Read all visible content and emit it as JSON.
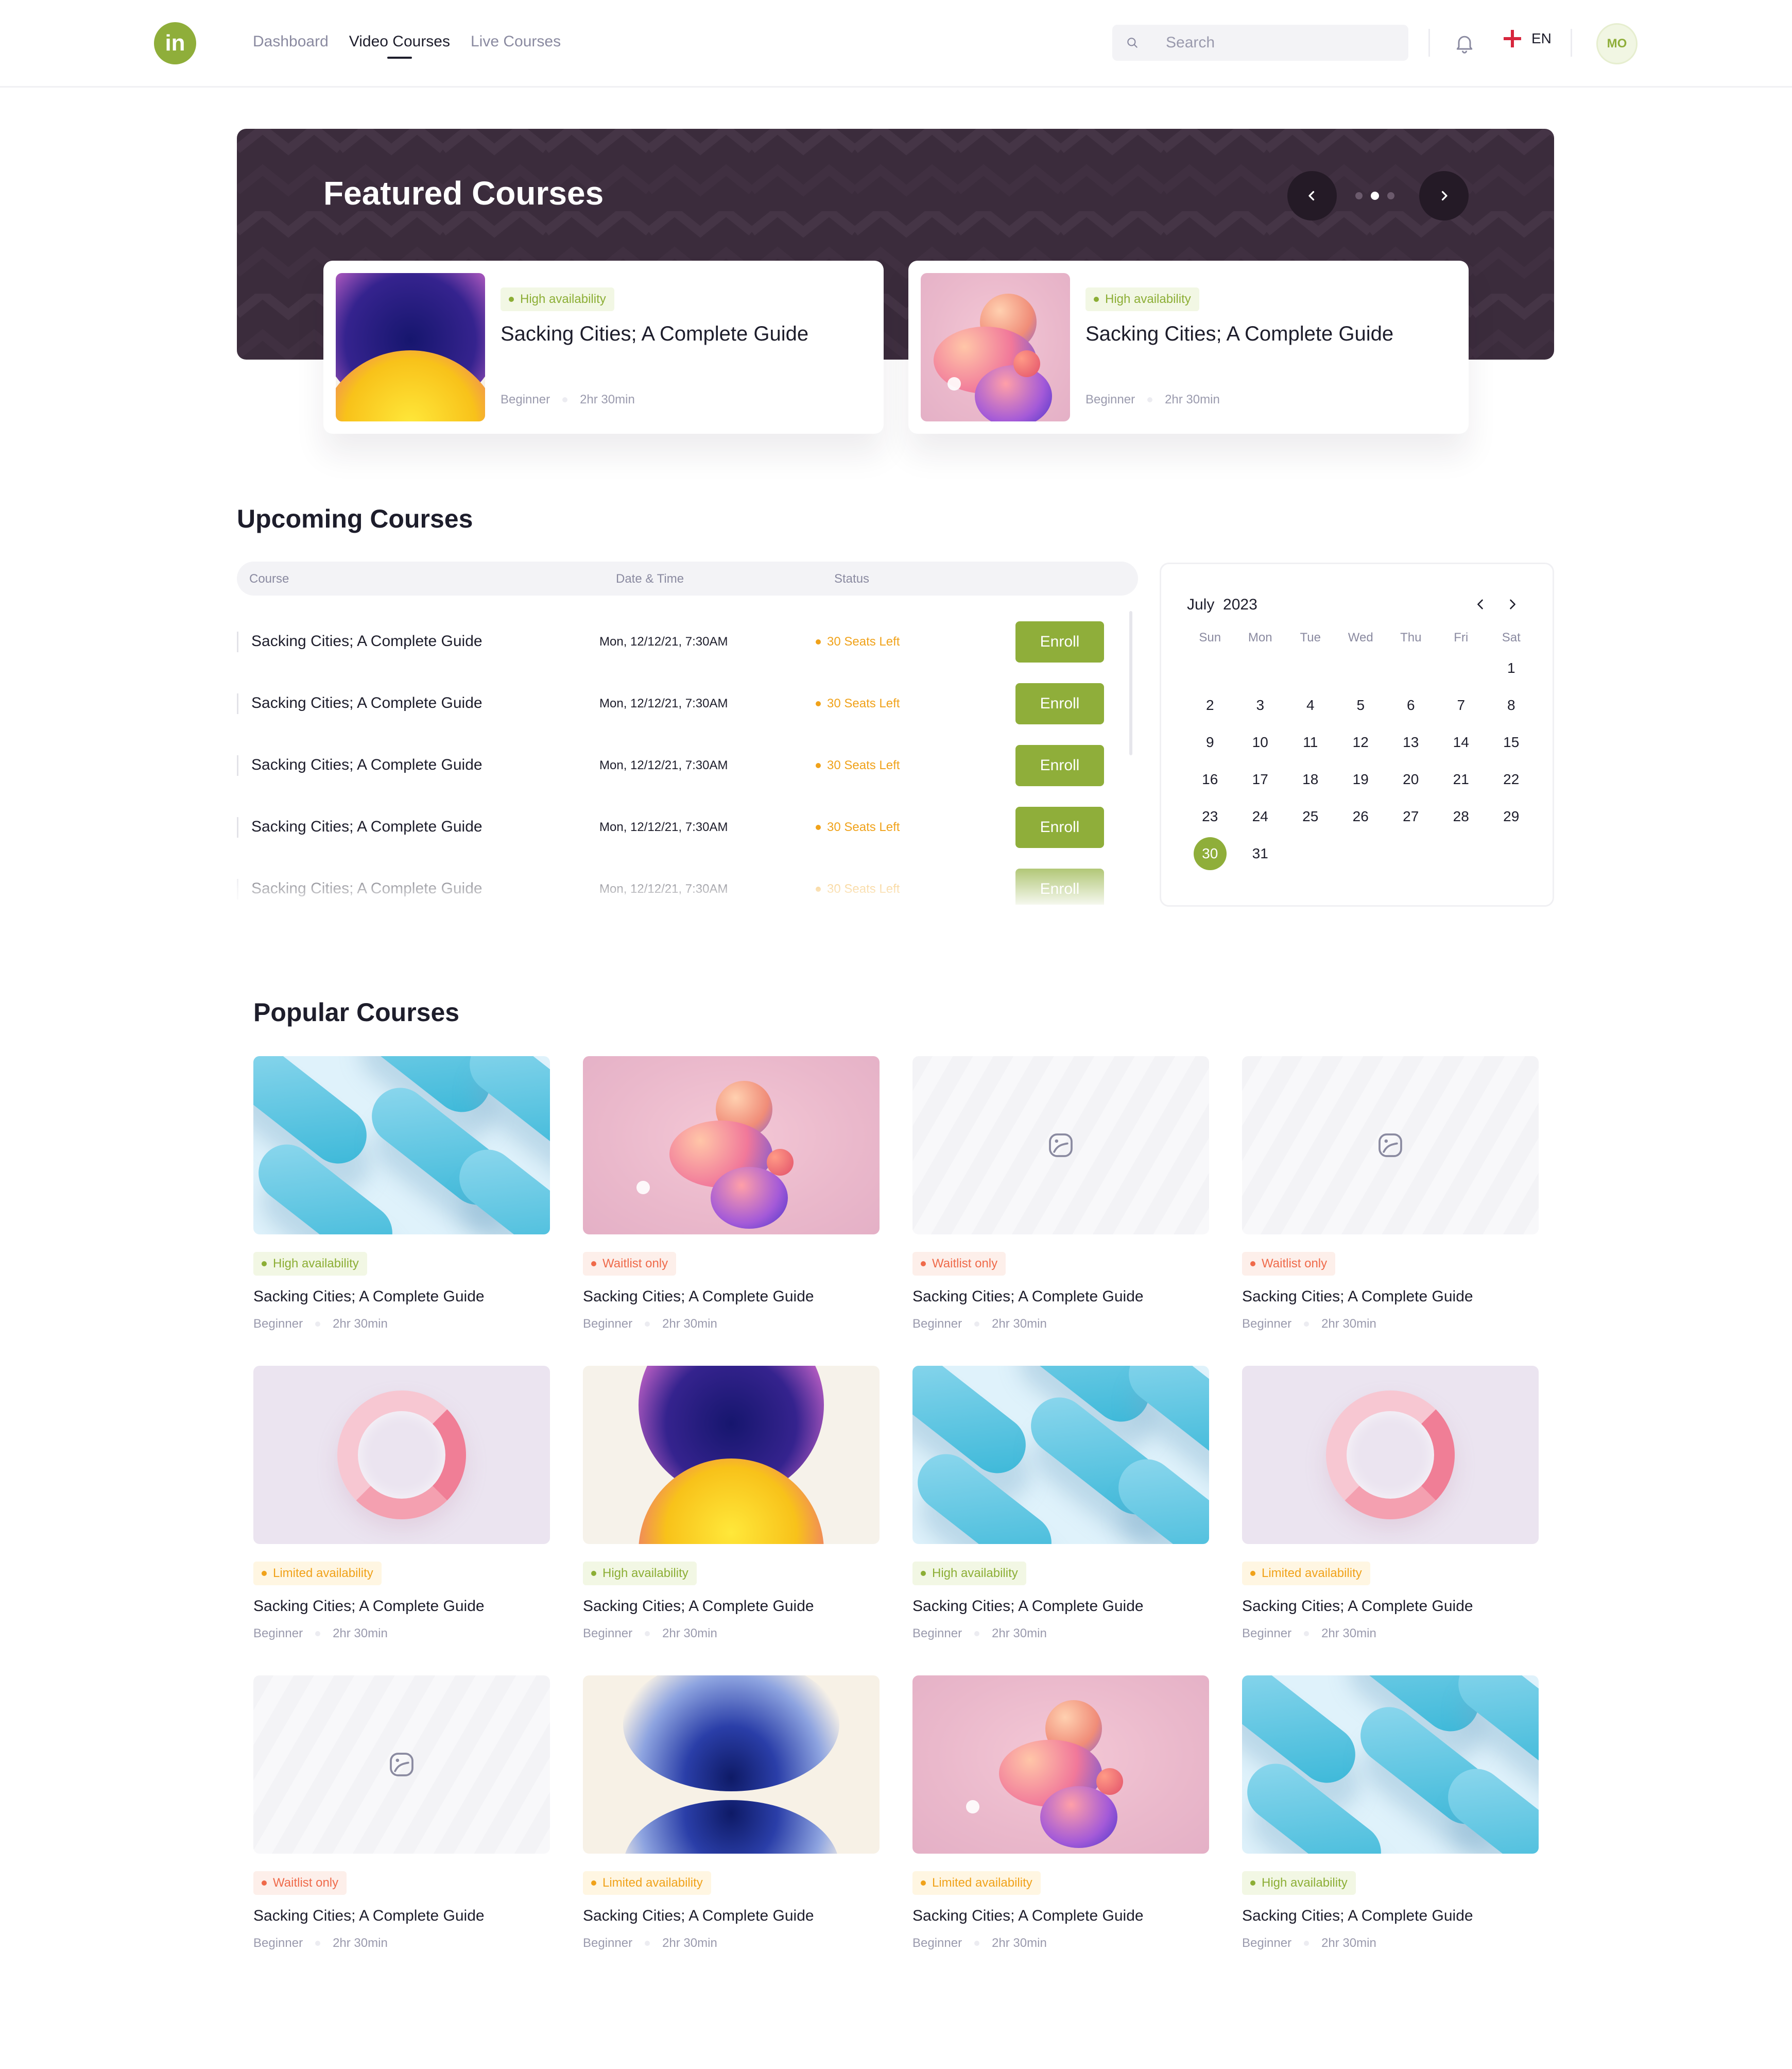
{
  "header": {
    "logo_text": "in",
    "nav": [
      {
        "label": "Dashboard",
        "active": false
      },
      {
        "label": "Video Courses",
        "active": true
      },
      {
        "label": "Live Courses",
        "active": false
      }
    ],
    "search_placeholder": "Search",
    "language": "EN",
    "avatar_initials": "MO"
  },
  "featured": {
    "title": "Featured Courses",
    "page_count": 3,
    "active_page": 2,
    "cards": [
      {
        "badge": "High availability",
        "badge_type": "green",
        "title": "Sacking Cities; A Complete Guide",
        "level": "Beginner",
        "duration": "2hr 30min",
        "image": "split-gradient"
      },
      {
        "badge": "High availability",
        "badge_type": "green",
        "title": "Sacking Cities; A Complete Guide",
        "level": "Beginner",
        "duration": "2hr 30min",
        "image": "pink-swirl"
      }
    ]
  },
  "upcoming": {
    "title": "Upcoming Courses",
    "columns": [
      "Course",
      "Date & Time",
      "Status"
    ],
    "enroll_label": "Enroll",
    "rows": [
      {
        "course": "Sacking Cities; A Complete Guide",
        "datetime": "Mon, 12/12/21, 7:30AM",
        "status": "30 Seats Left"
      },
      {
        "course": "Sacking Cities; A Complete Guide",
        "datetime": "Mon, 12/12/21, 7:30AM",
        "status": "30 Seats Left"
      },
      {
        "course": "Sacking Cities; A Complete Guide",
        "datetime": "Mon, 12/12/21, 7:30AM",
        "status": "30 Seats Left"
      },
      {
        "course": "Sacking Cities; A Complete Guide",
        "datetime": "Mon, 12/12/21, 7:30AM",
        "status": "30 Seats Left"
      },
      {
        "course": "Sacking Cities; A Complete Guide",
        "datetime": "Mon, 12/12/21, 7:30AM",
        "status": "30 Seats Left"
      }
    ]
  },
  "calendar": {
    "month": "July",
    "year": "2023",
    "weekdays": [
      "Sun",
      "Mon",
      "Tue",
      "Wed",
      "Thu",
      "Fri",
      "Sat"
    ],
    "first_weekday_index": 6,
    "days_in_month": 31,
    "selected_day": 30
  },
  "popular": {
    "title": "Popular Courses",
    "cards": [
      {
        "badge": "High availability",
        "badge_type": "green",
        "title": "Sacking Cities; A Complete Guide",
        "level": "Beginner",
        "duration": "2hr 30min",
        "image": "blue-tubes"
      },
      {
        "badge": "Waitlist only",
        "badge_type": "red",
        "title": "Sacking Cities; A Complete Guide",
        "level": "Beginner",
        "duration": "2hr 30min",
        "image": "pink-swirl"
      },
      {
        "badge": "Waitlist only",
        "badge_type": "red",
        "title": "Sacking Cities; A Complete Guide",
        "level": "Beginner",
        "duration": "2hr 30min",
        "image": "placeholder"
      },
      {
        "badge": "Waitlist only",
        "badge_type": "red",
        "title": "Sacking Cities; A Complete Guide",
        "level": "Beginner",
        "duration": "2hr 30min",
        "image": "placeholder"
      },
      {
        "badge": "Limited availability",
        "badge_type": "orange",
        "title": "Sacking Cities; A Complete Guide",
        "level": "Beginner",
        "duration": "2hr 30min",
        "image": "pink-ring"
      },
      {
        "badge": "High availability",
        "badge_type": "green",
        "title": "Sacking Cities; A Complete Guide",
        "level": "Beginner",
        "duration": "2hr 30min",
        "image": "split-gradient"
      },
      {
        "badge": "High availability",
        "badge_type": "green",
        "title": "Sacking Cities; A Complete Guide",
        "level": "Beginner",
        "duration": "2hr 30min",
        "image": "blue-tubes"
      },
      {
        "badge": "Limited availability",
        "badge_type": "orange",
        "title": "Sacking Cities; A Complete Guide",
        "level": "Beginner",
        "duration": "2hr 30min",
        "image": "pink-ring"
      },
      {
        "badge": "Waitlist only",
        "badge_type": "red",
        "title": "Sacking Cities; A Complete Guide",
        "level": "Beginner",
        "duration": "2hr 30min",
        "image": "placeholder"
      },
      {
        "badge": "Limited availability",
        "badge_type": "orange",
        "title": "Sacking Cities; A Complete Guide",
        "level": "Beginner",
        "duration": "2hr 30min",
        "image": "blue-hourglass"
      },
      {
        "badge": "Limited availability",
        "badge_type": "orange",
        "title": "Sacking Cities; A Complete Guide",
        "level": "Beginner",
        "duration": "2hr 30min",
        "image": "pink-swirl"
      },
      {
        "badge": "High availability",
        "badge_type": "green",
        "title": "Sacking Cities; A Complete Guide",
        "level": "Beginner",
        "duration": "2hr 30min",
        "image": "blue-tubes"
      }
    ]
  },
  "colors": {
    "accent": "#8fae3a",
    "hero_background": "#3b2c3c",
    "status_green": "#8cae35",
    "status_red": "#ef6a4a",
    "status_orange": "#f0a21a"
  }
}
